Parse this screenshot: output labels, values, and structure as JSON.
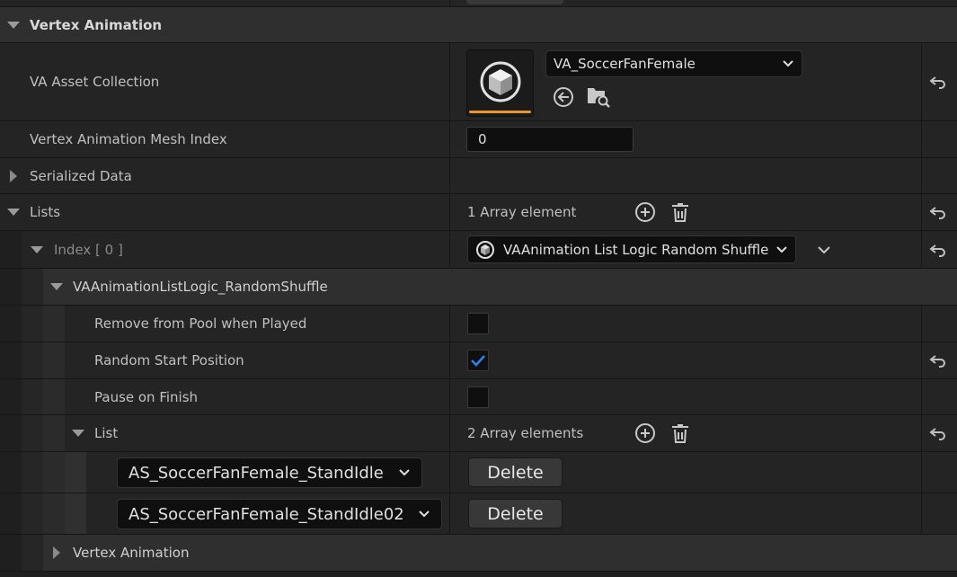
{
  "sections": {
    "vertex_animation": "Vertex Animation",
    "serialized_data": "Serialized Data",
    "lists": "Lists",
    "logic_category": "VAAnimationListLogic_RandomShuffle",
    "bottom_vertex_animation": "Vertex Animation"
  },
  "asset_collection": {
    "label": "VA Asset Collection",
    "value": "VA_SoccerFanFemale"
  },
  "mesh_index": {
    "label": "Vertex Animation Mesh Index",
    "value": "0"
  },
  "lists": {
    "count": "1 Array element"
  },
  "index0": {
    "label": "Index [ 0 ]",
    "value": "VAAnimation List Logic Random Shuffle"
  },
  "props": {
    "remove_from_pool": {
      "label": "Remove from Pool when Played",
      "checked": false
    },
    "random_start": {
      "label": "Random Start Position",
      "checked": true
    },
    "pause_on_finish": {
      "label": "Pause on Finish",
      "checked": false
    }
  },
  "list": {
    "label": "List",
    "count": "2 Array elements",
    "items": [
      {
        "value": "AS_SoccerFanFemale_StandIdle",
        "delete": "Delete"
      },
      {
        "value": "AS_SoccerFanFemale_StandIdle02",
        "delete": "Delete"
      }
    ]
  },
  "colors": {
    "accent": "#e8952a",
    "check": "#2f80ed"
  }
}
